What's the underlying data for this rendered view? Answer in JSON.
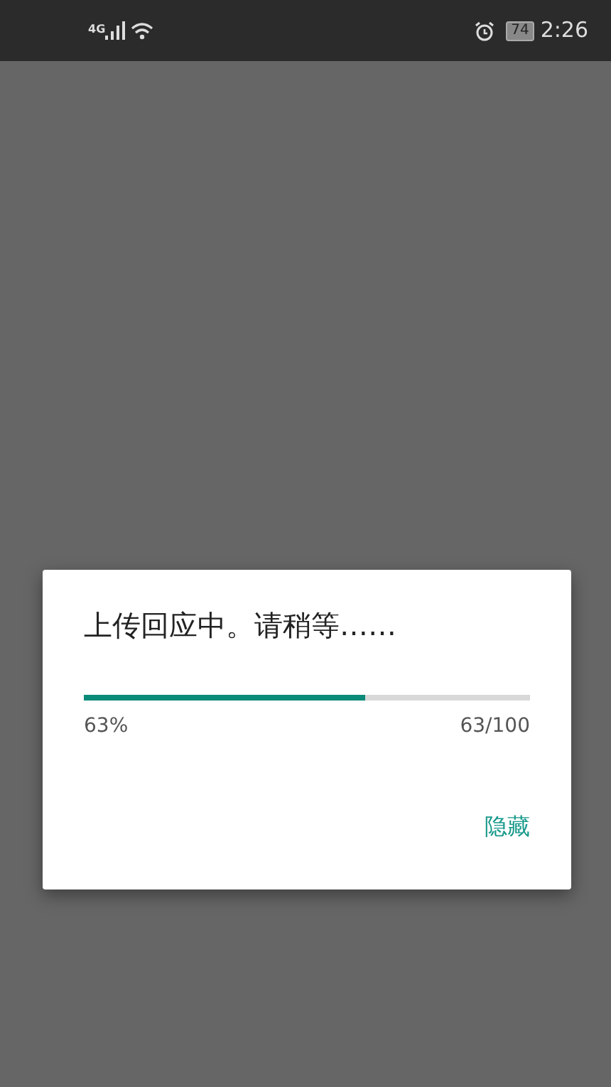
{
  "status_bar": {
    "network": "4G",
    "battery": "74",
    "time": "2:26"
  },
  "dialog": {
    "title": "上传回应中。请稍等……",
    "progress": {
      "level": 0.63,
      "percent": "63%",
      "count": "63/100"
    },
    "buttons": [
      {
        "label": "隐藏"
      }
    ]
  }
}
